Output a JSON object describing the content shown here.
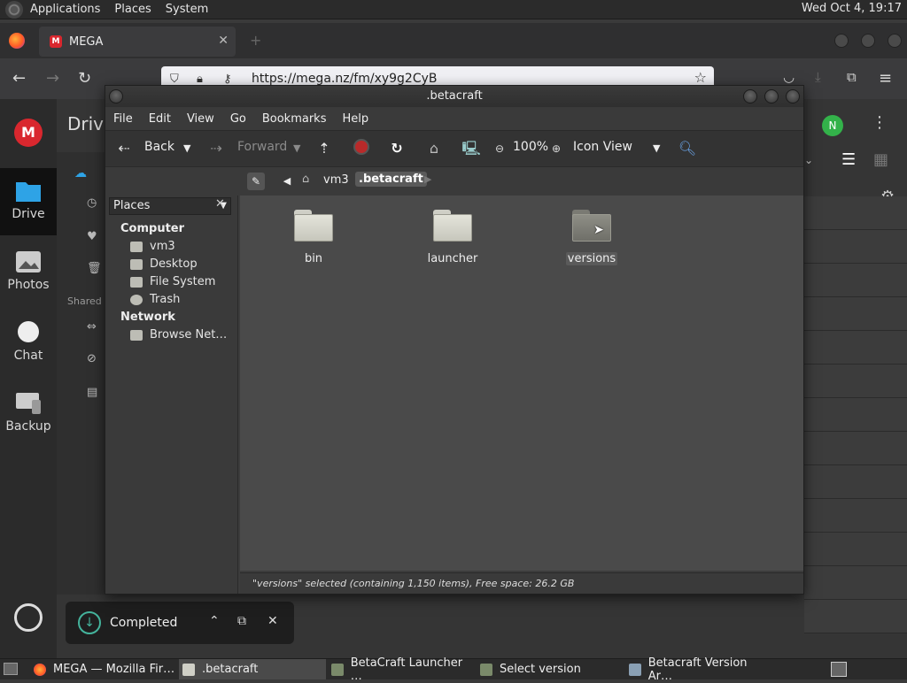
{
  "top_panel": {
    "menus": [
      "Applications",
      "Places",
      "System"
    ],
    "clock": "Wed Oct  4, 19:17"
  },
  "browser": {
    "tab_title": "MEGA",
    "url": "https://mega.nz/fm/xy9g2CyB"
  },
  "mega": {
    "page_title": "Drive",
    "nav": [
      "Drive",
      "Photos",
      "Chat",
      "Backup"
    ],
    "shared_label": "Shared",
    "avatar_initial": "N",
    "download": {
      "status": "Completed"
    }
  },
  "nautilus": {
    "window_title": ".betacraft",
    "menus": [
      "File",
      "Edit",
      "View",
      "Go",
      "Bookmarks",
      "Help"
    ],
    "toolbar": {
      "back": "Back",
      "forward": "Forward",
      "zoom": "100%",
      "view_mode": "Icon View"
    },
    "path": [
      "vm3",
      ".betacraft"
    ],
    "sidepane": {
      "selector": "Places",
      "sections": [
        {
          "title": "Computer",
          "items": [
            "vm3",
            "Desktop",
            "File System",
            "Trash"
          ]
        },
        {
          "title": "Network",
          "items": [
            "Browse Net…"
          ]
        }
      ]
    },
    "folders": [
      {
        "name": "bin",
        "selected": false
      },
      {
        "name": "launcher",
        "selected": false
      },
      {
        "name": "versions",
        "selected": true
      }
    ],
    "status": "\"versions\" selected (containing 1,150 items), Free space: 26.2 GB"
  },
  "taskbar": {
    "tasks": [
      {
        "label": "MEGA — Mozilla Fir…",
        "icon": "firefox-icon"
      },
      {
        "label": ".betacraft",
        "icon": "folder-icon",
        "active": true
      },
      {
        "label": "BetaCraft Launcher …",
        "icon": "app-icon"
      },
      {
        "label": "Select version",
        "icon": "app-icon"
      },
      {
        "label": "Betacraft Version Ar…",
        "icon": "app-icon"
      }
    ]
  }
}
